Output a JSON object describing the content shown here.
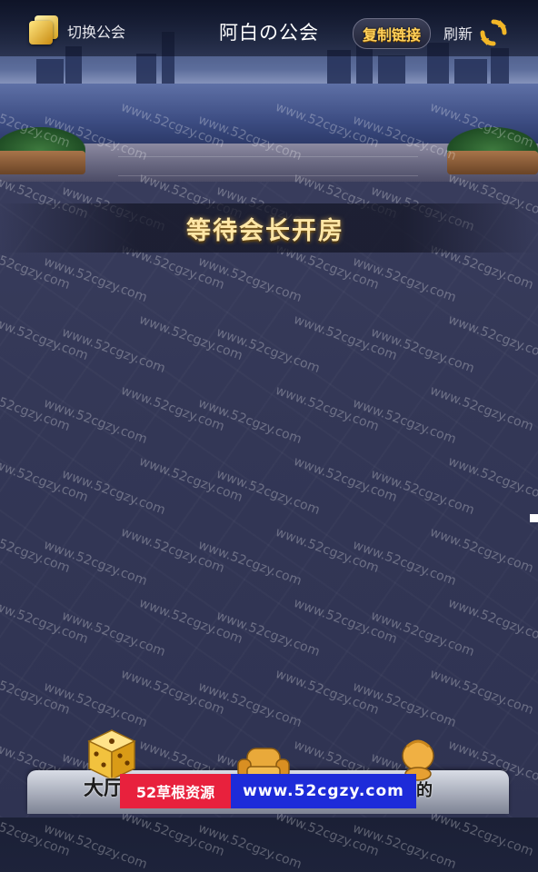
{
  "header": {
    "switch_guild_label": "切换公会",
    "guild_title": "阿白の公会",
    "copy_link_label": "复制链接",
    "refresh_label": "刷新"
  },
  "main": {
    "waiting_text": "等待会长开房"
  },
  "dock": {
    "lobby_label": "大厅",
    "mine_label": "的"
  },
  "ad": {
    "site_name": "52草根资源",
    "site_url": "www.52cgzy.com"
  },
  "watermark_text": "www.52cgzy.com",
  "colors": {
    "accent_gold": "#ffd15a",
    "banner_text": "#ffe7a6",
    "ad_red": "#e8213d",
    "ad_blue": "#1d2bd9"
  },
  "icons": [
    "guild-switch-icon",
    "refresh-icon",
    "dice-icon",
    "sofa-icon",
    "chick-icon"
  ]
}
